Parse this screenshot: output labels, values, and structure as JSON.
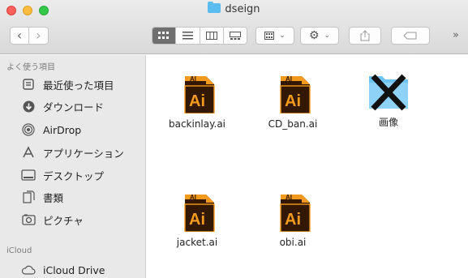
{
  "window": {
    "title": "dseign"
  },
  "toolbar": {
    "back_label": "‹",
    "forward_label": "›",
    "more_label": "»"
  },
  "sidebar": {
    "favorites_heading": "よく使う項目",
    "favorites": [
      {
        "label": "最近使った項目",
        "icon": "recents-icon"
      },
      {
        "label": "ダウンロード",
        "icon": "downloads-icon"
      },
      {
        "label": "AirDrop",
        "icon": "airdrop-icon"
      },
      {
        "label": "アプリケーション",
        "icon": "applications-icon"
      },
      {
        "label": "デスクトップ",
        "icon": "desktop-icon"
      },
      {
        "label": "書類",
        "icon": "documents-icon"
      },
      {
        "label": "ピクチャ",
        "icon": "pictures-icon"
      }
    ],
    "icloud_heading": "iCloud",
    "icloud": [
      {
        "label": "iCloud Drive",
        "icon": "icloud-icon"
      }
    ]
  },
  "files": [
    {
      "name": "backinlay.ai",
      "type": "ai",
      "badge": "Ai",
      "tab": "AI"
    },
    {
      "name": "CD_ban.ai",
      "type": "ai",
      "badge": "Ai",
      "tab": "AI"
    },
    {
      "name": "画像",
      "type": "folder"
    },
    {
      "name": "jacket.ai",
      "type": "ai",
      "badge": "Ai",
      "tab": "AI"
    },
    {
      "name": "obi.ai",
      "type": "ai",
      "badge": "Ai",
      "tab": "AI"
    }
  ],
  "colors": {
    "ai_orange": "#f29a1e",
    "ai_dark": "#321800",
    "folder_blue": "#6ec3f2"
  }
}
